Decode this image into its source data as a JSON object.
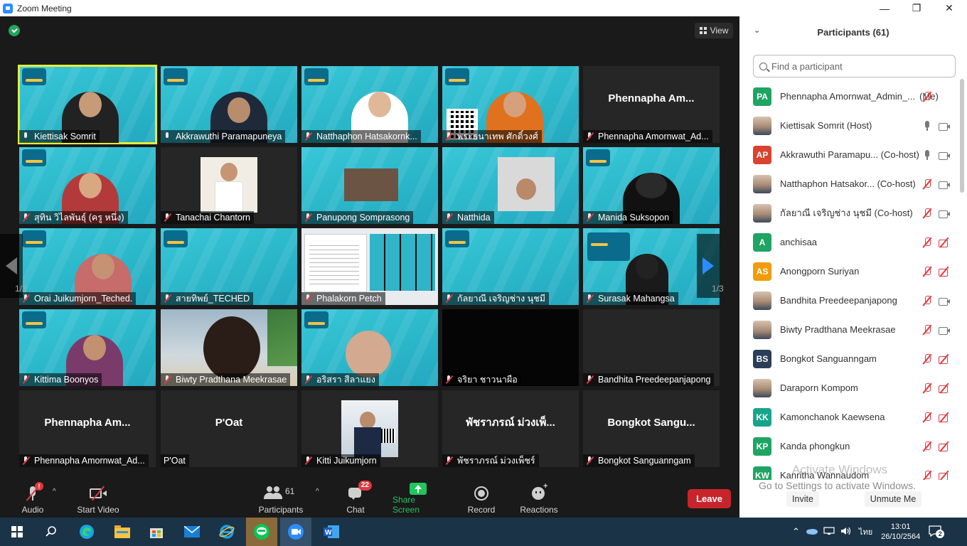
{
  "window": {
    "title": "Zoom Meeting",
    "minimize": "—",
    "maximize": "❐",
    "close": "✕"
  },
  "view_button": "View",
  "pages": {
    "left": "1/3",
    "right": "1/3"
  },
  "tiles": [
    {
      "name": "Kiettisak Somrit",
      "muted": false
    },
    {
      "name": "Akkrawuthi Paramapuneya",
      "muted": false
    },
    {
      "name": "Natthaphon Hatsakornk...",
      "muted": true
    },
    {
      "name": "พระธนาเทพ ศักดิ์วงศ์",
      "muted": true
    },
    {
      "name": "Phennapha Amornwat_Ad...",
      "big": "Phennapha Am...",
      "muted": true
    },
    {
      "name": "สุทิน วิไลพันธุ์ (ครู หนึ่ง)",
      "muted": true
    },
    {
      "name": "Tanachai Chantorn",
      "muted": true
    },
    {
      "name": "Panupong Somprasong",
      "muted": true
    },
    {
      "name": "Natthida",
      "muted": true
    },
    {
      "name": "Manida Suksopon",
      "muted": true
    },
    {
      "name": "Orai Juikumjorn_Teched.",
      "muted": true
    },
    {
      "name": "สายทิพย์_TECHED",
      "muted": true
    },
    {
      "name": "Phalakorn Petch",
      "muted": true
    },
    {
      "name": "กัลยาณี เจริญช่าง นุชมี",
      "muted": true
    },
    {
      "name": "Surasak Mahangsa",
      "muted": true
    },
    {
      "name": "Kittima Boonyos",
      "muted": true
    },
    {
      "name": "Biwty Pradthana Meekrasae",
      "muted": true
    },
    {
      "name": "อริสรา สีลาแยง",
      "muted": true
    },
    {
      "name": "จริยา ชาวนาผือ",
      "muted": true
    },
    {
      "name": "Bandhita Preedeepanjapong",
      "muted": true
    },
    {
      "name": "Phennapha Amornwat_Ad...",
      "big": "Phennapha Am...",
      "muted": true
    },
    {
      "name": "P'Oat",
      "big": "P'Oat",
      "muted": false
    },
    {
      "name": "Kitti Juikumjorn",
      "muted": true
    },
    {
      "name": "พัชราภรณ์ ม่วงเพ็ชร์",
      "big": "พัชราภรณ์ ม่วงเพ็...",
      "muted": true
    },
    {
      "name": "Bongkot Sanguanngam",
      "big": "Bongkot Sangu...",
      "muted": true
    }
  ],
  "toolbar": {
    "audio": "Audio",
    "audio_alert": "!",
    "start_video": "Start Video",
    "participants": "Participants",
    "participants_count": "61",
    "chat": "Chat",
    "chat_count": "22",
    "share_screen": "Share Screen",
    "record": "Record",
    "reactions": "Reactions",
    "leave": "Leave"
  },
  "panel": {
    "title": "Participants (61)",
    "search_placeholder": "Find a participant",
    "participants": [
      {
        "initials": "PA",
        "color": "#1fa463",
        "name": "Phennapha Amornwat_Admin_...",
        "tag": "(Me)",
        "mic": "off",
        "cam": "none"
      },
      {
        "initials": "",
        "color": "",
        "name": "Kiettisak Somrit (Host)",
        "tag": "",
        "mic": "on",
        "cam": "on"
      },
      {
        "initials": "AP",
        "color": "#d9432f",
        "name": "Akkrawuthi Paramapu... (Co-host)",
        "tag": "",
        "mic": "on",
        "cam": "on"
      },
      {
        "initials": "",
        "color": "",
        "name": "Natthaphon Hatsakor... (Co-host)",
        "tag": "",
        "mic": "off",
        "cam": "on"
      },
      {
        "initials": "",
        "color": "",
        "name": "กัลยาณี เจริญช่าง นุชมี (Co-host)",
        "tag": "",
        "mic": "off",
        "cam": "on"
      },
      {
        "initials": "A",
        "color": "#1fa463",
        "name": "anchisaa",
        "tag": "",
        "mic": "off",
        "cam": "off"
      },
      {
        "initials": "AS",
        "color": "#f29b0c",
        "name": "Anongporn Suriyan",
        "tag": "",
        "mic": "off",
        "cam": "off"
      },
      {
        "initials": "",
        "color": "",
        "name": "Bandhita Preedeepanjapong",
        "tag": "",
        "mic": "off",
        "cam": "on"
      },
      {
        "initials": "",
        "color": "",
        "name": "Biwty Pradthana Meekrasae",
        "tag": "",
        "mic": "off",
        "cam": "on"
      },
      {
        "initials": "BS",
        "color": "#2b3e57",
        "name": "Bongkot Sanguanngam",
        "tag": "",
        "mic": "off",
        "cam": "off"
      },
      {
        "initials": "",
        "color": "",
        "name": "Daraporn Kompom",
        "tag": "",
        "mic": "off",
        "cam": "off"
      },
      {
        "initials": "KK",
        "color": "#17a589",
        "name": "Kamonchanok Kaewsena",
        "tag": "",
        "mic": "off",
        "cam": "off"
      },
      {
        "initials": "KP",
        "color": "#1fa463",
        "name": "Kanda phongkun",
        "tag": "",
        "mic": "off",
        "cam": "off"
      },
      {
        "initials": "KW",
        "color": "#1fa463",
        "name": "Kanritha Wannaudom",
        "tag": "",
        "mic": "off",
        "cam": "off"
      }
    ],
    "activate_line1": "Activate Windows",
    "activate_line2": "Go to Settings to activate Windows.",
    "invite": "Invite",
    "unmute_me": "Unmute Me"
  },
  "taskbar": {
    "lang": "ไทย",
    "time": "13:01",
    "date": "26/10/2564",
    "notifications": "2"
  }
}
